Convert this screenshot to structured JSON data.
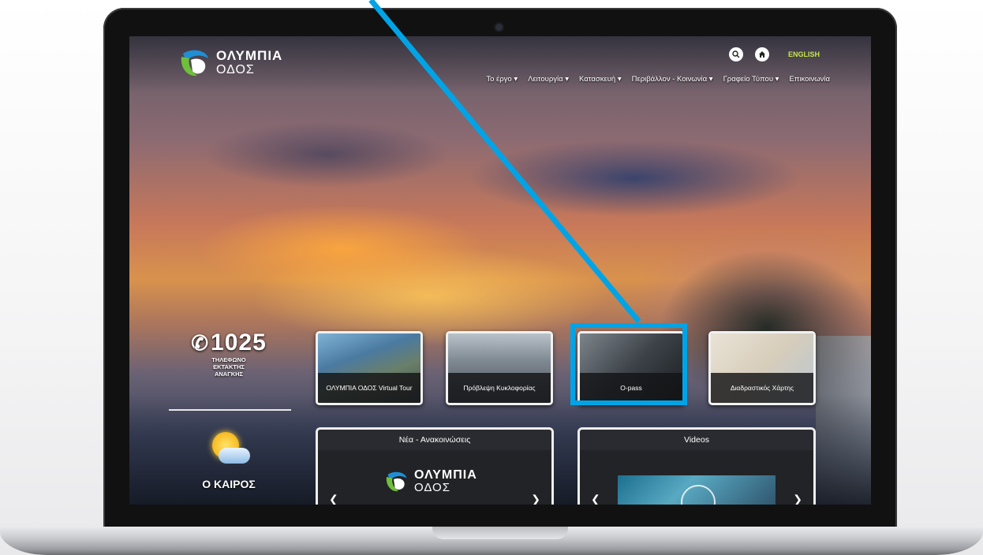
{
  "site": {
    "logo": {
      "line1": "ΟΛΥΜΠΙΑ",
      "line2": "ΟΔΟΣ"
    },
    "language_link": "ENGLISH",
    "nav": [
      {
        "label": "Το έργο ▾"
      },
      {
        "label": "Λειτουργία ▾"
      },
      {
        "label": "Κατασκευή ▾"
      },
      {
        "label": "Περιβάλλον - Κοινωνία ▾"
      },
      {
        "label": "Γραφείο Τύπου ▾"
      },
      {
        "label": "Επικοινωνία"
      }
    ],
    "emergency": {
      "number": "1025",
      "caption": [
        "ΤΗΛΕΦΩΝΟ",
        "ΕΚΤΑΚΤΗΣ",
        "ΑΝΑΓΚΗΣ"
      ]
    },
    "weather": {
      "label": "Ο ΚΑΙΡΟΣ"
    },
    "tiles": [
      {
        "label": "ΟΛΥΜΠΙΑ ΟΔΟΣ Virtual Tour"
      },
      {
        "label": "Πρόβλεψη Κυκλοφορίας"
      },
      {
        "label": "O-pass"
      },
      {
        "label": "Διαδραστικός Χάρτης"
      }
    ],
    "panels": {
      "news": {
        "title": "Νέα - Ανακοινώσεις"
      },
      "videos": {
        "title": "Videos"
      }
    }
  },
  "colors": {
    "highlight": "#00a4e6",
    "accent_lang": "#c6e74a",
    "logo_green": "#6fbf3a",
    "logo_blue": "#1e8fd6"
  },
  "icons": [
    "search-icon",
    "home-icon",
    "phone-icon",
    "weather-icon",
    "chevron-left-icon",
    "chevron-right-icon",
    "play-icon"
  ]
}
